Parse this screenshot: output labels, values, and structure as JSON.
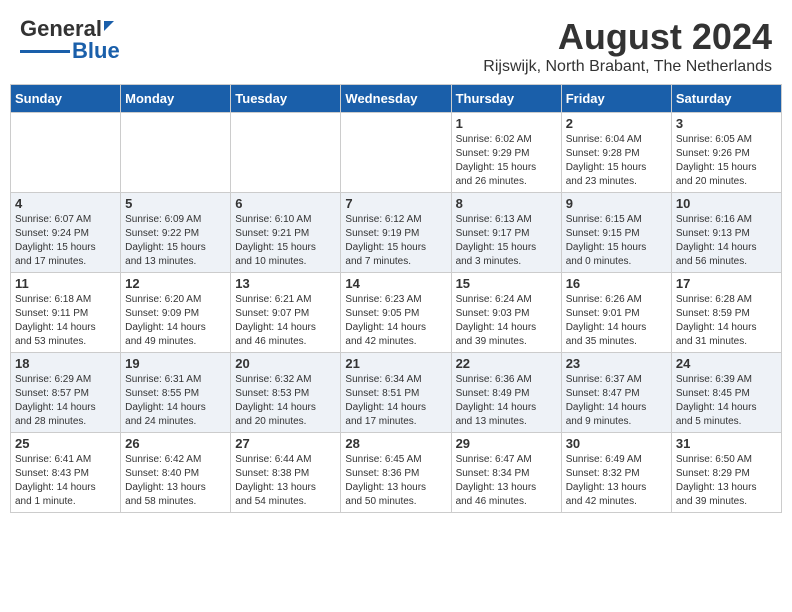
{
  "header": {
    "logo_general": "General",
    "logo_blue": "Blue",
    "month_year": "August 2024",
    "location": "Rijswijk, North Brabant, The Netherlands"
  },
  "days_of_week": [
    "Sunday",
    "Monday",
    "Tuesday",
    "Wednesday",
    "Thursday",
    "Friday",
    "Saturday"
  ],
  "weeks": [
    [
      {
        "day": "",
        "info": ""
      },
      {
        "day": "",
        "info": ""
      },
      {
        "day": "",
        "info": ""
      },
      {
        "day": "",
        "info": ""
      },
      {
        "day": "1",
        "info": "Sunrise: 6:02 AM\nSunset: 9:29 PM\nDaylight: 15 hours\nand 26 minutes."
      },
      {
        "day": "2",
        "info": "Sunrise: 6:04 AM\nSunset: 9:28 PM\nDaylight: 15 hours\nand 23 minutes."
      },
      {
        "day": "3",
        "info": "Sunrise: 6:05 AM\nSunset: 9:26 PM\nDaylight: 15 hours\nand 20 minutes."
      }
    ],
    [
      {
        "day": "4",
        "info": "Sunrise: 6:07 AM\nSunset: 9:24 PM\nDaylight: 15 hours\nand 17 minutes."
      },
      {
        "day": "5",
        "info": "Sunrise: 6:09 AM\nSunset: 9:22 PM\nDaylight: 15 hours\nand 13 minutes."
      },
      {
        "day": "6",
        "info": "Sunrise: 6:10 AM\nSunset: 9:21 PM\nDaylight: 15 hours\nand 10 minutes."
      },
      {
        "day": "7",
        "info": "Sunrise: 6:12 AM\nSunset: 9:19 PM\nDaylight: 15 hours\nand 7 minutes."
      },
      {
        "day": "8",
        "info": "Sunrise: 6:13 AM\nSunset: 9:17 PM\nDaylight: 15 hours\nand 3 minutes."
      },
      {
        "day": "9",
        "info": "Sunrise: 6:15 AM\nSunset: 9:15 PM\nDaylight: 15 hours\nand 0 minutes."
      },
      {
        "day": "10",
        "info": "Sunrise: 6:16 AM\nSunset: 9:13 PM\nDaylight: 14 hours\nand 56 minutes."
      }
    ],
    [
      {
        "day": "11",
        "info": "Sunrise: 6:18 AM\nSunset: 9:11 PM\nDaylight: 14 hours\nand 53 minutes."
      },
      {
        "day": "12",
        "info": "Sunrise: 6:20 AM\nSunset: 9:09 PM\nDaylight: 14 hours\nand 49 minutes."
      },
      {
        "day": "13",
        "info": "Sunrise: 6:21 AM\nSunset: 9:07 PM\nDaylight: 14 hours\nand 46 minutes."
      },
      {
        "day": "14",
        "info": "Sunrise: 6:23 AM\nSunset: 9:05 PM\nDaylight: 14 hours\nand 42 minutes."
      },
      {
        "day": "15",
        "info": "Sunrise: 6:24 AM\nSunset: 9:03 PM\nDaylight: 14 hours\nand 39 minutes."
      },
      {
        "day": "16",
        "info": "Sunrise: 6:26 AM\nSunset: 9:01 PM\nDaylight: 14 hours\nand 35 minutes."
      },
      {
        "day": "17",
        "info": "Sunrise: 6:28 AM\nSunset: 8:59 PM\nDaylight: 14 hours\nand 31 minutes."
      }
    ],
    [
      {
        "day": "18",
        "info": "Sunrise: 6:29 AM\nSunset: 8:57 PM\nDaylight: 14 hours\nand 28 minutes."
      },
      {
        "day": "19",
        "info": "Sunrise: 6:31 AM\nSunset: 8:55 PM\nDaylight: 14 hours\nand 24 minutes."
      },
      {
        "day": "20",
        "info": "Sunrise: 6:32 AM\nSunset: 8:53 PM\nDaylight: 14 hours\nand 20 minutes."
      },
      {
        "day": "21",
        "info": "Sunrise: 6:34 AM\nSunset: 8:51 PM\nDaylight: 14 hours\nand 17 minutes."
      },
      {
        "day": "22",
        "info": "Sunrise: 6:36 AM\nSunset: 8:49 PM\nDaylight: 14 hours\nand 13 minutes."
      },
      {
        "day": "23",
        "info": "Sunrise: 6:37 AM\nSunset: 8:47 PM\nDaylight: 14 hours\nand 9 minutes."
      },
      {
        "day": "24",
        "info": "Sunrise: 6:39 AM\nSunset: 8:45 PM\nDaylight: 14 hours\nand 5 minutes."
      }
    ],
    [
      {
        "day": "25",
        "info": "Sunrise: 6:41 AM\nSunset: 8:43 PM\nDaylight: 14 hours\nand 1 minute."
      },
      {
        "day": "26",
        "info": "Sunrise: 6:42 AM\nSunset: 8:40 PM\nDaylight: 13 hours\nand 58 minutes."
      },
      {
        "day": "27",
        "info": "Sunrise: 6:44 AM\nSunset: 8:38 PM\nDaylight: 13 hours\nand 54 minutes."
      },
      {
        "day": "28",
        "info": "Sunrise: 6:45 AM\nSunset: 8:36 PM\nDaylight: 13 hours\nand 50 minutes."
      },
      {
        "day": "29",
        "info": "Sunrise: 6:47 AM\nSunset: 8:34 PM\nDaylight: 13 hours\nand 46 minutes."
      },
      {
        "day": "30",
        "info": "Sunrise: 6:49 AM\nSunset: 8:32 PM\nDaylight: 13 hours\nand 42 minutes."
      },
      {
        "day": "31",
        "info": "Sunrise: 6:50 AM\nSunset: 8:29 PM\nDaylight: 13 hours\nand 39 minutes."
      }
    ]
  ]
}
